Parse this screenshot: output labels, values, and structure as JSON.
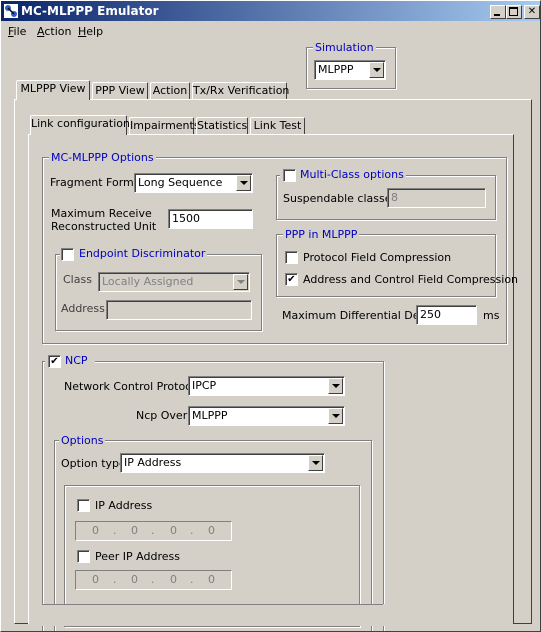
{
  "window": {
    "title": "MC-MLPPP Emulator"
  },
  "menu": {
    "items": [
      "File",
      "Action",
      "Help"
    ],
    "mnemonics": [
      "F",
      "A",
      "H"
    ],
    "rest": [
      "ile",
      "ction",
      "elp"
    ]
  },
  "simulation": {
    "label": "Simulation",
    "value": "MLPPP"
  },
  "main_tabs": [
    "MLPPP View",
    "PPP View",
    "Action",
    "Tx/Rx Verification"
  ],
  "sub_tabs": [
    "Link configuration",
    "Impairments",
    "Statistics",
    "Link Test"
  ],
  "mc_mlppp": {
    "title": "MC-MLPPP Options",
    "fragment_format_label": "Fragment Format",
    "fragment_format_value": "Long Sequence",
    "mrru_label_line1": "Maximum Receive",
    "mrru_label_line2": "Reconstructed Unit",
    "mrru_value": "1500",
    "endpoint": {
      "title": "Endpoint Discriminator",
      "checked": false,
      "class_label": "Class",
      "class_value": "Locally Assigned",
      "address_label": "Address",
      "address_value": ""
    }
  },
  "multi_class": {
    "title": "Multi-Class options",
    "checked": false,
    "suspendable_label": "Suspendable classes",
    "suspendable_value": "8"
  },
  "ppp_in_mlppp": {
    "title": "PPP in MLPPP",
    "protocol_field_compression": "Protocol Field Compression",
    "protocol_field_checked": false,
    "acfc": "Address and Control Field Compression",
    "acfc_checked": true
  },
  "max_diff_delay": {
    "label": "Maximum Differential Delay",
    "value": "250",
    "unit": "ms"
  },
  "ncp": {
    "title": "NCP",
    "checked": true,
    "protocol_label": "Network Control Protocol",
    "protocol_value": "IPCP",
    "over_label": "Ncp Over",
    "over_value": "MLPPP",
    "options": {
      "title": "Options",
      "type_label": "Option type",
      "type_value": "IP Address",
      "ip_address_label": "IP Address",
      "ip_address_checked": false,
      "ip_address_value": [
        "0",
        "0",
        "0",
        "0"
      ],
      "peer_ip_label": "Peer IP Address",
      "peer_ip_checked": false,
      "peer_ip_value": [
        "0",
        "0",
        "0",
        "0"
      ]
    }
  },
  "colors": {
    "titlebar_start": "#0a246a",
    "titlebar_end": "#a6caf0",
    "group_title": "#0000c0",
    "face": "#d4d0c8"
  }
}
